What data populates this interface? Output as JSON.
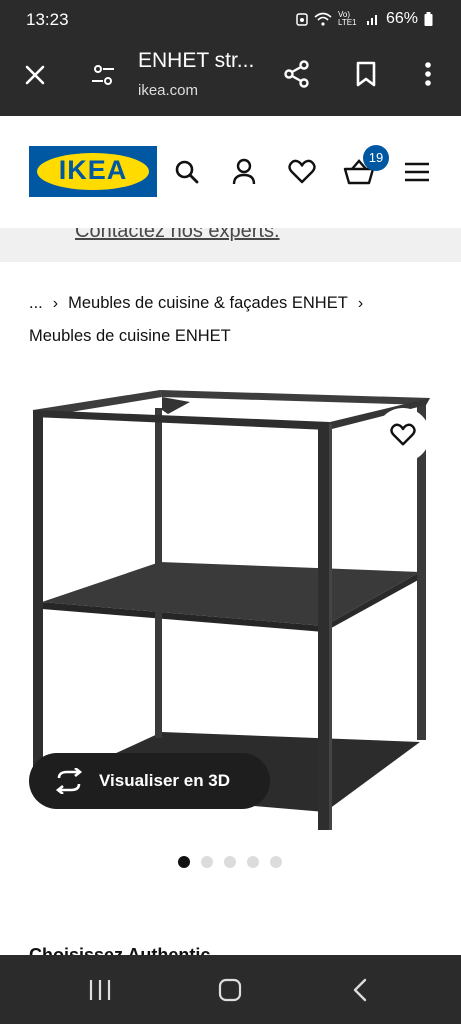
{
  "status_bar": {
    "time": "13:23",
    "network": "Vo) LTE1",
    "battery": "66%"
  },
  "browser": {
    "title": "ENHET str...",
    "url": "ikea.com"
  },
  "header": {
    "logo_text": "IKEA",
    "cart_count": "19",
    "brand_colors": {
      "blue": "#0058a3",
      "yellow": "#ffdb00"
    }
  },
  "contact": {
    "link_text": "Contactez nos experts."
  },
  "breadcrumb": {
    "ellipsis": "...",
    "item1": "Meubles de cuisine & façades ENHET",
    "item2": "Meubles de cuisine ENHET"
  },
  "product": {
    "view_3d_label": "Visualiser en 3D",
    "image_count": 5,
    "active_image": 1
  },
  "peek_text": "Choisissez  Authentic"
}
